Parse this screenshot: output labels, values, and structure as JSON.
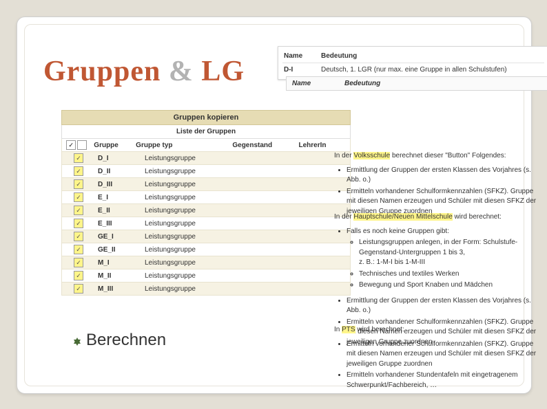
{
  "title": {
    "part1": "Gruppen",
    "amp": " & ",
    "part2": "LG"
  },
  "def_table": {
    "head": {
      "c1": "Name",
      "c2": "Bedeutung"
    },
    "row1": {
      "c1": "D-I",
      "c2": "Deutsch, 1. LGR (nur max. eine Gruppe in allen Schulstufen)"
    }
  },
  "def_table2": {
    "c1": "Name",
    "c2": "Bedeutung"
  },
  "group_panel": {
    "title": "Gruppen kopieren",
    "subtitle": "Liste der Gruppen",
    "head": {
      "gruppe": "Gruppe",
      "typ": "Gruppe typ",
      "gegen": "Gegenstand",
      "lehr": "LehrerIn"
    },
    "rows": [
      {
        "name": "D_I",
        "type": "Leistungsgruppe"
      },
      {
        "name": "D_II",
        "type": "Leistungsgruppe"
      },
      {
        "name": "D_III",
        "type": "Leistungsgruppe"
      },
      {
        "name": "E_I",
        "type": "Leistungsgruppe"
      },
      {
        "name": "E_II",
        "type": "Leistungsgruppe"
      },
      {
        "name": "E_III",
        "type": "Leistungsgruppe"
      },
      {
        "name": "GE_I",
        "type": "Leistungsgruppe"
      },
      {
        "name": "GE_II",
        "type": "Leistungsgruppe"
      },
      {
        "name": "M_I",
        "type": "Leistungsgruppe"
      },
      {
        "name": "M_II",
        "type": "Leistungsgruppe"
      },
      {
        "name": "M_III",
        "type": "Leistungsgruppe"
      }
    ]
  },
  "right": {
    "vs": {
      "lead_a": "In der ",
      "hl": "Volksschule",
      "lead_b": " berechnet dieser \"Button\" Folgendes:",
      "li1": "Ermittlung der Gruppen der ersten Klassen des Vorjahres (s. Abb. o.)",
      "li2": "Ermitteln vorhandener Schulformkennzahlen (SFKZ). Gruppe mit diesen Namen erzeugen und Schüler mit diesen SFKZ der jeweiligen Gruppe zuordnen"
    },
    "hs": {
      "lead_a": "In der ",
      "hl": "Hauptschule/Neuen Mittelschule",
      "lead_b": " wird berechnet:",
      "li0": "Falls es noch keine Gruppen gibt:",
      "sub1": "Leistungsgruppen anlegen, in der Form: Schulstufe-Gegenstand-Untergruppen 1 bis 3,",
      "sub1b": "z. B.: 1-M-I bis 1-M-III",
      "sub2": "Technisches und textiles Werken",
      "sub3": "Bewegung und Sport Knaben und Mädchen",
      "li1": "Ermittlung der Gruppen der ersten Klassen des Vorjahres (s. Abb. o.)",
      "li2": "Ermitteln vorhandener Schulformkennzahlen (SFKZ). Gruppe mit diesen Namen erzeugen und Schüler mit diesen SFKZ der jeweiligen Gruppe zuordnen"
    },
    "pts": {
      "lead_a": "In ",
      "hl": "PTS",
      "lead_b": " wird berechnet:",
      "li1": "Ermitteln vorhandener Schulformkennzahlen (SFKZ). Gruppe mit diesen Namen erzeugen und Schüler mit diesen SFKZ der jeweiligen Gruppe zuordnen",
      "li2": "Ermitteln vorhandener Stundentafeln mit eingetragenem Schwerpunkt/Fachbereich, …"
    }
  },
  "berechnen": "Berechnen",
  "check": "✓"
}
